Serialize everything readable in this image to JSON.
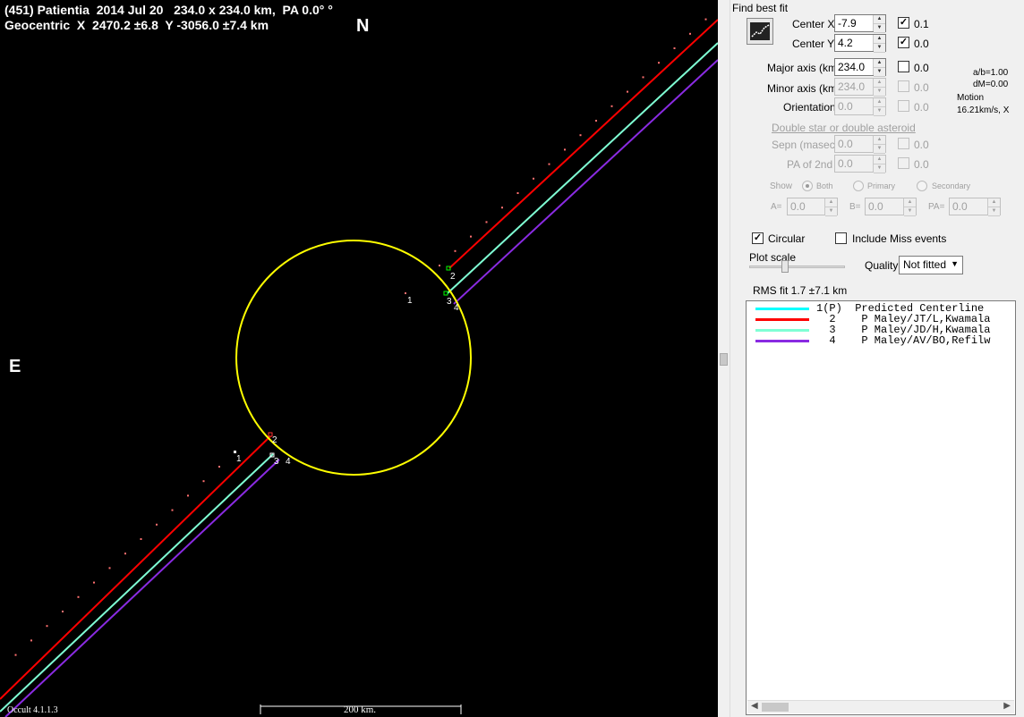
{
  "plot": {
    "header_line1": "(451) Patientia  2014 Jul 20   234.0 x 234.0 km,  PA 0.0° °",
    "header_line2": "Geocentric  X  2470.2 ±6.8  Y -3056.0 ±7.4 km",
    "compass_north": "N",
    "compass_east": "E",
    "version": "Occult 4.1.1.3",
    "scale_label": "200 km.",
    "colors": {
      "ellipse": "#ffff00",
      "predicted_dots": "#ff7070",
      "chord2": "#ff0000",
      "chord3": "#7fffd4",
      "chord4": "#8a2be2",
      "predicted_centerline": "#00ffff"
    },
    "markers": {
      "top_1": "1",
      "top_2": "2",
      "top_3": "3",
      "top_4": "4",
      "bot_1": "1",
      "bot_2": "2",
      "bot_3": "3",
      "bot_4": "4"
    }
  },
  "panel": {
    "find_best_fit": "Find best fit",
    "fit_button_icon": "chart-fit-icon",
    "center_x": {
      "label": "Center X",
      "value": "-7.9",
      "check_label": "0.1",
      "checked": true
    },
    "center_y": {
      "label": "Center Y",
      "value": "4.2",
      "check_label": "0.0",
      "checked": true
    },
    "major_axis": {
      "label": "Major axis (km)",
      "value": "234.0",
      "check_label": "0.0"
    },
    "minor_axis": {
      "label": "Minor axis (km)",
      "value": "234.0",
      "check_label": "0.0"
    },
    "orientation": {
      "label": "Orientation",
      "value": "0.0",
      "check_label": "0.0"
    },
    "ratio_ab": "a/b=1.00",
    "ratio_dm": "dM=0.00",
    "motion_label": "Motion",
    "motion_value": "16.21km/s, X",
    "double_star": "Double star  or  double asteroid",
    "sepn": {
      "label": "Sepn (masec)",
      "value": "0.0",
      "check_label": "0.0"
    },
    "pa2": {
      "label": "PA of 2nd",
      "value": "0.0",
      "check_label": "0.0"
    },
    "show_label": "Show",
    "show_both": "Both",
    "show_primary": "Primary",
    "show_secondary": "Secondary",
    "a_label": "A=",
    "a_value": "0.0",
    "b_label": "B=",
    "b_value": "0.0",
    "pa_label": "PA=",
    "pa_value": "0.0",
    "circular": "Circular",
    "include_miss": "Include Miss events",
    "plot_scale": "Plot scale",
    "quality_label": "Quality",
    "quality_value": "Not fitted",
    "rms_fit": "RMS fit  1.7 ±7.1 km",
    "legend": [
      {
        "text": "1(P)  Predicted Centerline",
        "color": "#00ffff"
      },
      {
        "text": "  2    P Maley/JT/L,Kwamala",
        "color": "#ff0000"
      },
      {
        "text": "  3    P Maley/JD/H,Kwamala",
        "color": "#7fffd4"
      },
      {
        "text": "  4    P Maley/AV/BO,Refilw",
        "color": "#8a2be2"
      }
    ]
  }
}
